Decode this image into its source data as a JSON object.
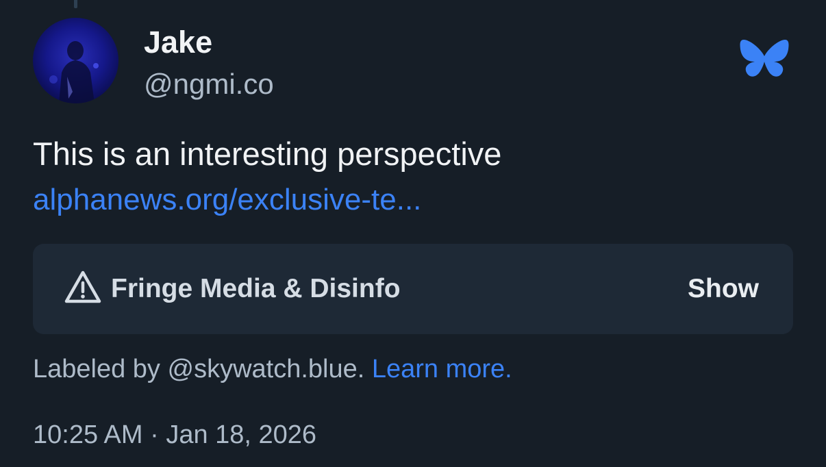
{
  "post": {
    "author": {
      "display_name": "Jake",
      "handle": "@ngmi.co",
      "avatar_icon": "user-avatar-photo"
    },
    "app_icon": "bluesky-butterfly-icon",
    "text": "This is an interesting perspective",
    "link_text": "alphanews.org/exclusive-te...",
    "content_label": {
      "icon": "warning-triangle-icon",
      "text": "Fringe Media & Disinfo",
      "show_label": "Show"
    },
    "labeled_by": {
      "prefix": "Labeled by @skywatch.blue.",
      "learn_more": "Learn more."
    },
    "timestamp": "10:25 AM · Jan 18, 2026"
  },
  "colors": {
    "background": "#161e27",
    "accent": "#3b82f6",
    "label_box": "#1e2936",
    "muted_text": "#aebbc9"
  }
}
